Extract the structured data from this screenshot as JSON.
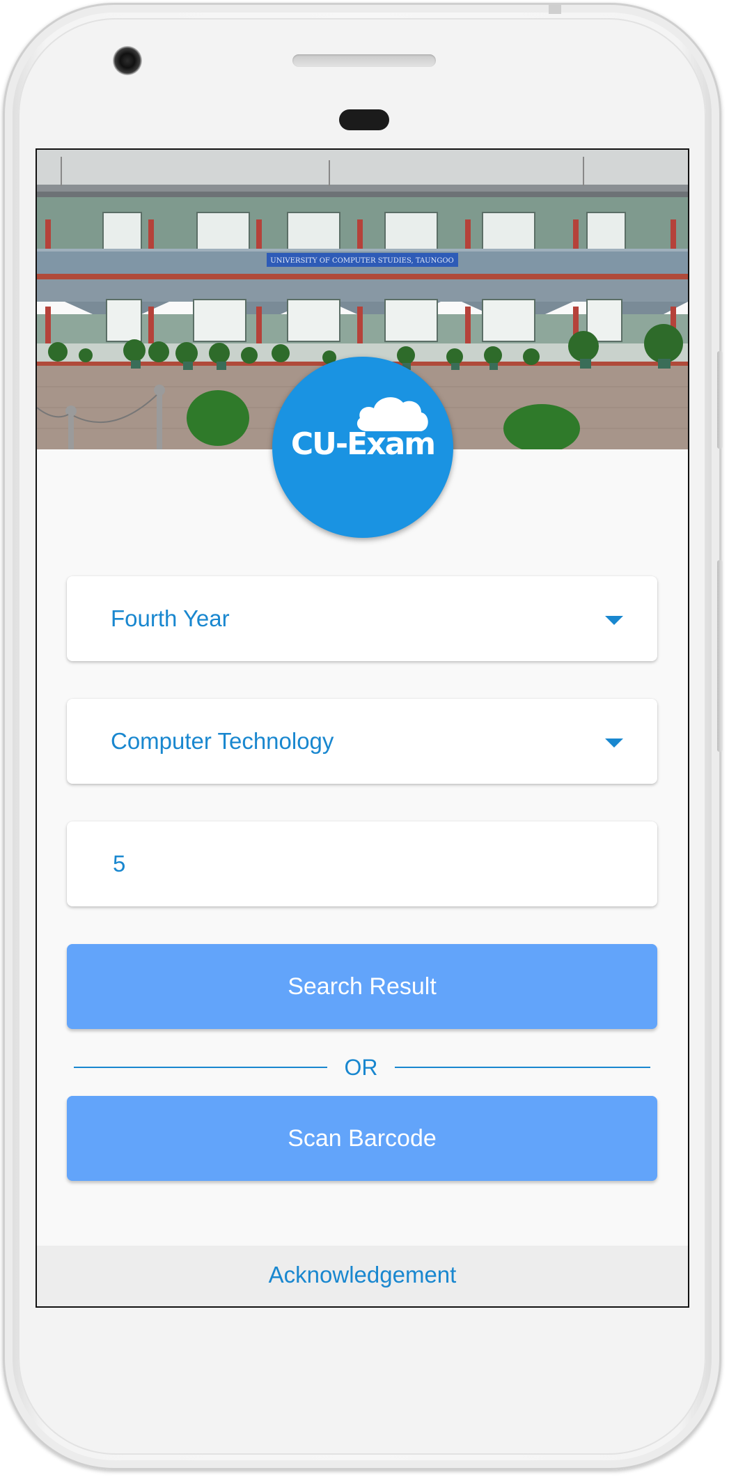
{
  "app": {
    "logo_text": "CU-Exam",
    "banner_sign": "UNIVERSITY OF COMPUTER STUDIES, TAUNGOO"
  },
  "form": {
    "year_select": {
      "value": "Fourth Year"
    },
    "major_select": {
      "value": "Computer Technology"
    },
    "roll_input": {
      "value": "5"
    },
    "search_button": "Search Result",
    "divider_text": "OR",
    "scan_button": "Scan Barcode"
  },
  "footer": {
    "link": "Acknowledgement"
  },
  "colors": {
    "accent": "#1987cf",
    "button": "#62a4fa",
    "logo_bg": "#1a93e2"
  }
}
